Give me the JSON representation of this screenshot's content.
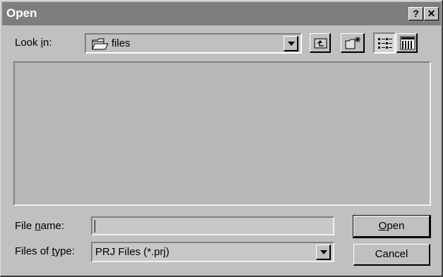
{
  "window": {
    "title": "Open",
    "help_glyph": "?",
    "close_glyph": "✕"
  },
  "look_in": {
    "label_pre": "Look ",
    "label_key": "i",
    "label_post": "n:",
    "value": "files",
    "icon": "open-folder-icon"
  },
  "toolbar": {
    "up_icon": "up-one-level-icon",
    "new_folder_icon": "new-folder-icon",
    "list_icon": "list-view-icon",
    "details_icon": "details-view-icon"
  },
  "file_name": {
    "label_pre": "File ",
    "label_key": "n",
    "label_post": "ame:",
    "value": ""
  },
  "file_type": {
    "label_pre": "Files of ",
    "label_key": "t",
    "label_post": "ype:",
    "value": "PRJ Files (*.prj)"
  },
  "buttons": {
    "open_key": "O",
    "open_rest": "pen",
    "cancel": "Cancel"
  },
  "colors": {
    "titlebar": "#7e7e7e",
    "face": "#c0c0c0",
    "list_bg": "#b8b8b8"
  }
}
